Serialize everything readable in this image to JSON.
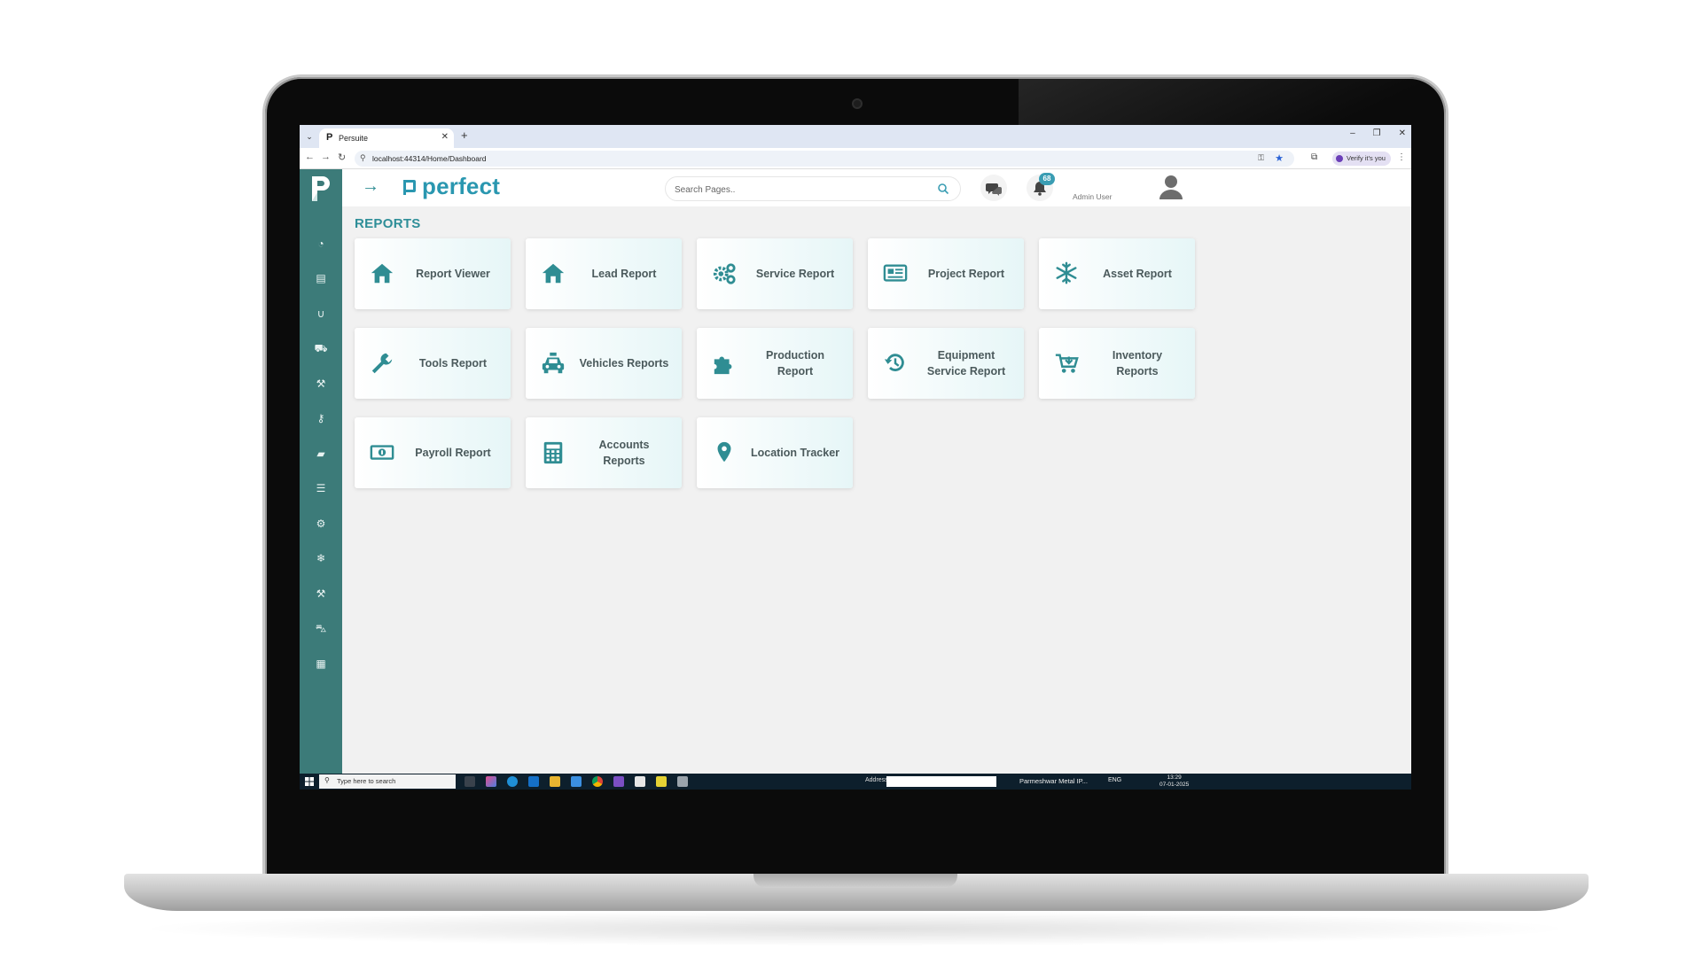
{
  "browser": {
    "tab_title": "Persuite",
    "tab_favicon": "P",
    "url": "localhost:44314/Home/Dashboard",
    "verify_label": "Verify it's you",
    "icons": [
      "back-arrow-icon",
      "forward-arrow-icon",
      "reload-icon",
      "site-info-icon",
      "password-key-icon",
      "bookmark-star-icon",
      "extensions-icon",
      "menu-dots-icon"
    ]
  },
  "header": {
    "brand": "perfect",
    "search_placeholder": "Search Pages..",
    "notification_count": "68",
    "user_name": "Admin User"
  },
  "sidebar": {
    "items": [
      {
        "icon": "dashboard-icon",
        "glyph": "◔"
      },
      {
        "icon": "document-icon",
        "glyph": "▤"
      },
      {
        "icon": "magnet-icon",
        "glyph": "∪"
      },
      {
        "icon": "cart-icon",
        "glyph": "⛟"
      },
      {
        "icon": "wrench-icon",
        "glyph": "⚒"
      },
      {
        "icon": "key-icon",
        "glyph": "⚷"
      },
      {
        "icon": "book-icon",
        "glyph": "▰"
      },
      {
        "icon": "list-icon",
        "glyph": "☰"
      },
      {
        "icon": "gear-icon",
        "glyph": "⚙"
      },
      {
        "icon": "snowflake-icon",
        "glyph": "❄"
      },
      {
        "icon": "tools-icon",
        "glyph": "⚒"
      },
      {
        "icon": "car-icon",
        "glyph": "⛍"
      },
      {
        "icon": "calculator-icon",
        "glyph": "▦"
      }
    ]
  },
  "page": {
    "title": "REPORTS"
  },
  "reports": [
    {
      "label": "Report Viewer",
      "icon": "home-icon"
    },
    {
      "label": "Lead Report",
      "icon": "home-icon"
    },
    {
      "label": "Service Report",
      "icon": "gears-icon"
    },
    {
      "label": "Project Report",
      "icon": "newspaper-icon"
    },
    {
      "label": "Asset Report",
      "icon": "snowflake-icon"
    },
    {
      "label": "Tools Report",
      "icon": "wrench-icon"
    },
    {
      "label": "Vehicles Reports",
      "icon": "taxi-icon"
    },
    {
      "label": "Production\nReport",
      "icon": "puzzle-icon"
    },
    {
      "label": "Equipment\nService Report",
      "icon": "history-icon"
    },
    {
      "label": "Inventory\nReports",
      "icon": "cart-arrow-icon"
    },
    {
      "label": "Payroll Report",
      "icon": "money-bill-icon"
    },
    {
      "label": "Accounts\nReports",
      "icon": "calculator-icon"
    },
    {
      "label": "Location Tracker",
      "icon": "map-marker-icon"
    }
  ],
  "taskbar": {
    "search_placeholder": "Type here to search",
    "address_label": "Address",
    "running_app": "Parmeshwar Metal IP...",
    "language": "ENG",
    "time": "13:29",
    "date": "07-01-2025"
  },
  "colors": {
    "sidebar": "#3c7b79",
    "accent": "#2a97b0",
    "icon_teal": "#2f8d93",
    "card_text": "#4b5a5c"
  }
}
